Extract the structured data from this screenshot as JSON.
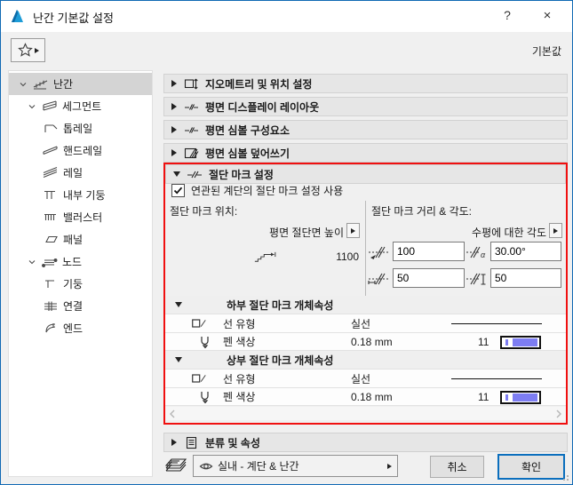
{
  "window": {
    "title": "난간 기본값 설정",
    "help_label": "?",
    "close_label": "×"
  },
  "toolbar": {
    "default_label": "기본값"
  },
  "sidebar": {
    "items": [
      {
        "label": "난간",
        "level": 0,
        "selected": true,
        "expanded": true,
        "icon": "railing-icon"
      },
      {
        "label": "세그먼트",
        "level": 1,
        "selected": false,
        "expanded": true,
        "icon": "segment-icon"
      },
      {
        "label": "톱레일",
        "level": 2,
        "selected": false,
        "icon": "top-rail-icon"
      },
      {
        "label": "핸드레일",
        "level": 2,
        "selected": false,
        "icon": "handrail-icon"
      },
      {
        "label": "레일",
        "level": 2,
        "selected": false,
        "icon": "rail-icon"
      },
      {
        "label": "내부 기둥",
        "level": 2,
        "selected": false,
        "icon": "inner-post-icon"
      },
      {
        "label": "밸러스터",
        "level": 2,
        "selected": false,
        "icon": "baluster-icon"
      },
      {
        "label": "패널",
        "level": 2,
        "selected": false,
        "icon": "panel-icon"
      },
      {
        "label": "노드",
        "level": 1,
        "selected": false,
        "expanded": true,
        "icon": "node-icon"
      },
      {
        "label": "기둥",
        "level": 2,
        "selected": false,
        "icon": "post-icon"
      },
      {
        "label": "연결",
        "level": 2,
        "selected": false,
        "icon": "connection-icon"
      },
      {
        "label": "엔드",
        "level": 2,
        "selected": false,
        "icon": "end-icon"
      }
    ]
  },
  "sections": [
    {
      "label": "지오메트리 및 위치 설정",
      "expanded": false
    },
    {
      "label": "평면 디스플레이 레이아웃",
      "expanded": false
    },
    {
      "label": "평면 심볼 구성요소",
      "expanded": false
    },
    {
      "label": "평면 심볼 덮어쓰기",
      "expanded": false
    },
    {
      "label": "절단 마크 설정",
      "expanded": true
    },
    {
      "label": "분류 및 속성",
      "expanded": false
    }
  ],
  "cut_mark": {
    "linked_checkbox": {
      "checked": true,
      "label": "연관된 계단의 절단 마크 설정 사용"
    },
    "position_group": {
      "title": "절단 마크 위치:",
      "flyout_label": "평면 절단면 높이",
      "height_value": "1100"
    },
    "distance_group": {
      "title": "절단 마크 거리 & 각도:",
      "flyout_label": "수평에 대한 각도",
      "distance": "100",
      "angle": "30.00°",
      "lower_offset": "50",
      "upper_offset": "50"
    },
    "lower_group": {
      "title": "하부 절단 마크 개체속성",
      "line_type_label": "선 유형",
      "line_type_value": "실선",
      "pen_label": "펜 색상",
      "pen_weight": "0.18 mm",
      "pen_index": "11"
    },
    "upper_group": {
      "title": "상부 절단 마크 개체속성",
      "line_type_label": "선 유형",
      "line_type_value": "실선",
      "pen_label": "펜 색상",
      "pen_weight": "0.18 mm",
      "pen_index": "11"
    }
  },
  "footer": {
    "layer_value": "실내 - 계단 & 난간",
    "cancel_label": "취소",
    "ok_label": "확인"
  },
  "colors": {
    "accent_blue": "#0a6ebd",
    "annotation_red": "#f01010",
    "pen_swatch_purple": "#7d7df2",
    "section_header_gray": "#e6e6e6",
    "selected_row_gray": "#d4d4d4"
  }
}
